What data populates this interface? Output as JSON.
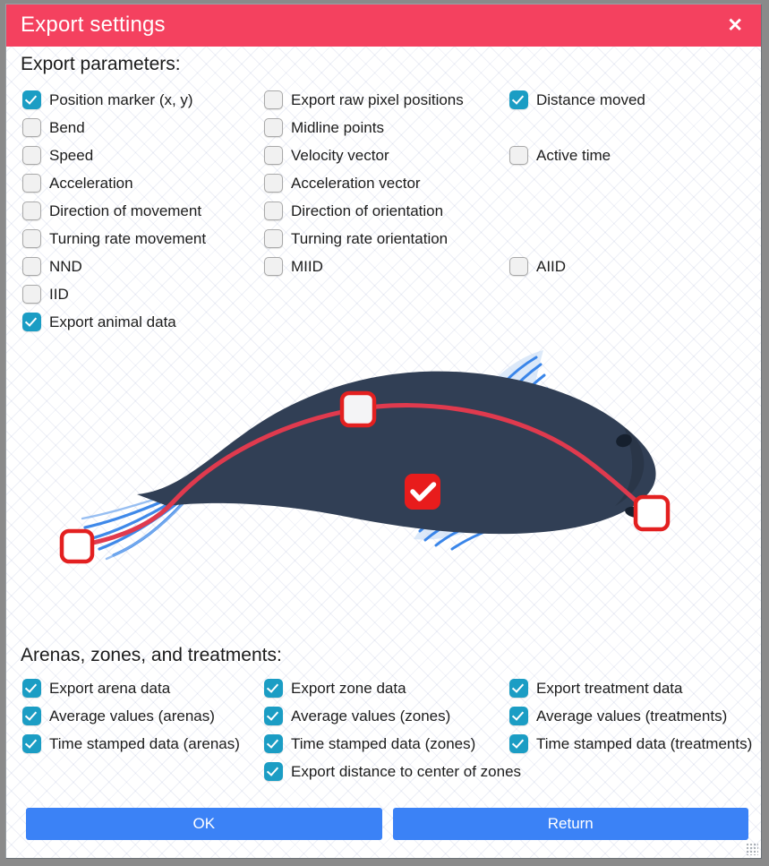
{
  "window": {
    "title": "Export settings",
    "close_icon": "close-icon",
    "resize_grip_icon": "resize-grip-icon"
  },
  "sections": {
    "parameters": {
      "heading": "Export parameters:",
      "columns": [
        [
          {
            "label": "Position marker (x, y)",
            "checked": true
          },
          {
            "label": "Bend",
            "checked": false
          },
          {
            "label": "Speed",
            "checked": false
          },
          {
            "label": "Acceleration",
            "checked": false
          },
          {
            "label": "Direction of movement",
            "checked": false
          },
          {
            "label": "Turning rate movement",
            "checked": false
          },
          {
            "label": "NND",
            "checked": false
          },
          {
            "label": "IID",
            "checked": false
          },
          {
            "label": "Export animal data",
            "checked": true
          }
        ],
        [
          {
            "label": "Export raw pixel positions",
            "checked": false
          },
          {
            "label": "Midline points",
            "checked": false
          },
          {
            "label": "Velocity vector",
            "checked": false
          },
          {
            "label": "Acceleration vector",
            "checked": false
          },
          {
            "label": "Direction of orientation",
            "checked": false
          },
          {
            "label": "Turning rate orientation",
            "checked": false
          },
          {
            "label": "MIID",
            "checked": false
          }
        ],
        [
          {
            "label": "Distance moved",
            "checked": true,
            "row": 0
          },
          {
            "label": "Active time",
            "checked": false,
            "row": 2
          },
          {
            "label": "AIID",
            "checked": false,
            "row": 6
          }
        ]
      ]
    },
    "arenas_zones_treatments": {
      "heading": "Arenas, zones, and treatments:",
      "columns": [
        [
          {
            "label": "Export arena data",
            "checked": true
          },
          {
            "label": "Average values (arenas)",
            "checked": true
          },
          {
            "label": "Time stamped data (arenas)",
            "checked": true
          }
        ],
        [
          {
            "label": "Export zone data",
            "checked": true
          },
          {
            "label": "Average values (zones)",
            "checked": true
          },
          {
            "label": "Time stamped data (zones)",
            "checked": true
          },
          {
            "label": "Export distance to center of zones",
            "checked": true
          }
        ],
        [
          {
            "label": "Export treatment data",
            "checked": true
          },
          {
            "label": "Average values (treatments)",
            "checked": true
          },
          {
            "label": "Time stamped data (treatments)",
            "checked": true
          }
        ]
      ]
    }
  },
  "illustration": {
    "name": "fish-midline-tracking-illustration",
    "body_color": "#313f55",
    "fin_color": "#2f7fe8",
    "midline_color": "#e03a4e",
    "marker_outline_color": "#e32020",
    "badge_color": "#e81c1c",
    "markers": [
      "tail-tip-marker",
      "mid-body-marker",
      "head-marker"
    ],
    "badge_icon": "check-badge-icon"
  },
  "footer": {
    "ok_label": "OK",
    "return_label": "Return"
  },
  "theme": {
    "titlebar": "#f4415f",
    "accent_checkbox": "#1b9dc4",
    "button": "#3b82f6"
  }
}
